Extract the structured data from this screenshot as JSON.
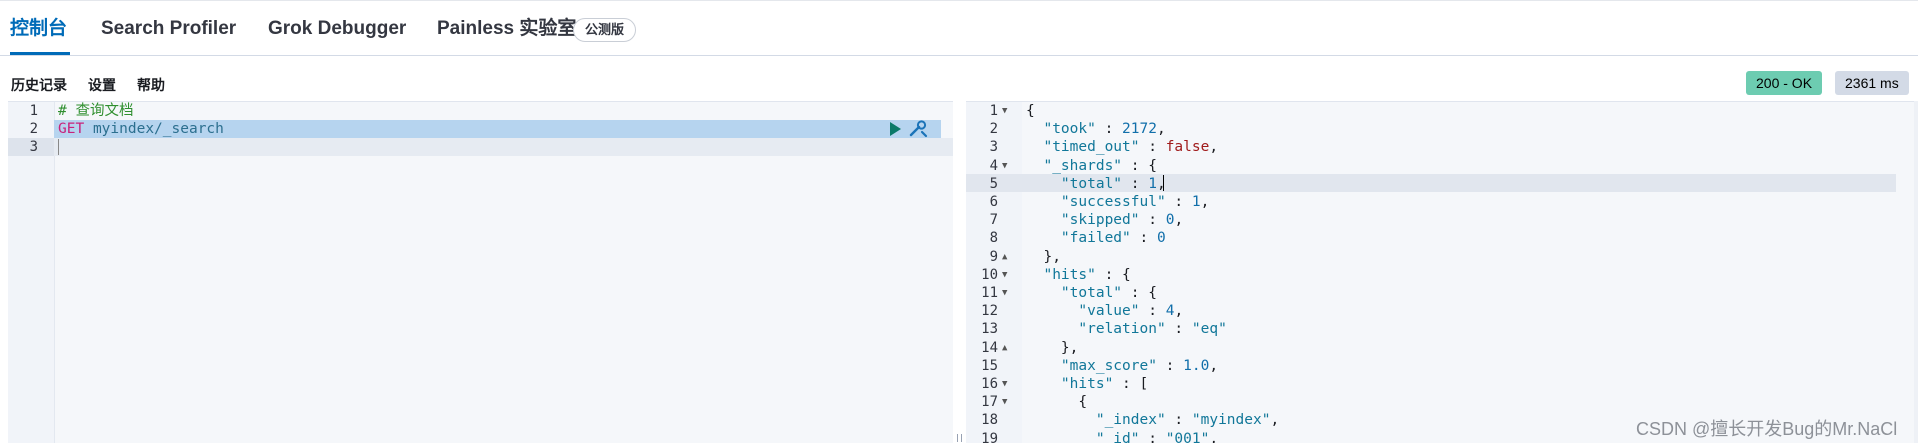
{
  "tabs": [
    {
      "label": "控制台",
      "active": true
    },
    {
      "label": "Search Profiler",
      "active": false
    },
    {
      "label": "Grok Debugger",
      "active": false
    },
    {
      "label": "Painless 实验室",
      "active": false
    }
  ],
  "beta_badge": "公测版",
  "toolbar": {
    "history": "历史记录",
    "settings": "设置",
    "help": "帮助"
  },
  "status": {
    "code": "200 - OK",
    "time": "2361 ms"
  },
  "request": {
    "line_numbers": [
      "1",
      "2",
      "3"
    ],
    "comment": "# 查询文档",
    "method": "GET",
    "path": "myindex/_search"
  },
  "response": {
    "line_numbers": [
      "1",
      "2",
      "3",
      "4",
      "5",
      "6",
      "7",
      "8",
      "9",
      "10",
      "11",
      "12",
      "13",
      "14",
      "15",
      "16",
      "17",
      "18",
      "19"
    ],
    "lines": [
      [
        [
          "p",
          "{"
        ]
      ],
      [
        [
          "k",
          "  \"took\""
        ],
        [
          "p",
          " : "
        ],
        [
          "n",
          "2172"
        ],
        [
          "p",
          ","
        ]
      ],
      [
        [
          "k",
          "  \"timed_out\""
        ],
        [
          "p",
          " : "
        ],
        [
          "b",
          "false"
        ],
        [
          "p",
          ","
        ]
      ],
      [
        [
          "k",
          "  \"_shards\""
        ],
        [
          "p",
          " : {"
        ]
      ],
      [
        [
          "k",
          "    \"total\""
        ],
        [
          "p",
          " : "
        ],
        [
          "n",
          "1"
        ],
        [
          "p",
          ","
        ]
      ],
      [
        [
          "k",
          "    \"successful\""
        ],
        [
          "p",
          " : "
        ],
        [
          "n",
          "1"
        ],
        [
          "p",
          ","
        ]
      ],
      [
        [
          "k",
          "    \"skipped\""
        ],
        [
          "p",
          " : "
        ],
        [
          "n",
          "0"
        ],
        [
          "p",
          ","
        ]
      ],
      [
        [
          "k",
          "    \"failed\""
        ],
        [
          "p",
          " : "
        ],
        [
          "n",
          "0"
        ]
      ],
      [
        [
          "p",
          "  },"
        ]
      ],
      [
        [
          "k",
          "  \"hits\""
        ],
        [
          "p",
          " : {"
        ]
      ],
      [
        [
          "k",
          "    \"total\""
        ],
        [
          "p",
          " : {"
        ]
      ],
      [
        [
          "k",
          "      \"value\""
        ],
        [
          "p",
          " : "
        ],
        [
          "n",
          "4"
        ],
        [
          "p",
          ","
        ]
      ],
      [
        [
          "k",
          "      \"relation\""
        ],
        [
          "p",
          " : "
        ],
        [
          "s",
          "\"eq\""
        ]
      ],
      [
        [
          "p",
          "    },"
        ]
      ],
      [
        [
          "k",
          "    \"max_score\""
        ],
        [
          "p",
          " : "
        ],
        [
          "n",
          "1.0"
        ],
        [
          "p",
          ","
        ]
      ],
      [
        [
          "k",
          "    \"hits\""
        ],
        [
          "p",
          " : ["
        ]
      ],
      [
        [
          "p",
          "      {"
        ]
      ],
      [
        [
          "k",
          "        \"_index\""
        ],
        [
          "p",
          " : "
        ],
        [
          "s",
          "\"myindex\""
        ],
        [
          "p",
          ","
        ]
      ],
      [
        [
          "k",
          "        \"_id\""
        ],
        [
          "p",
          " : "
        ],
        [
          "s",
          "\"001\""
        ],
        [
          "p",
          ","
        ]
      ]
    ]
  },
  "watermark": "CSDN @擅长开发Bug的Mr.NaCl",
  "colors": {
    "accent": "#006bb8",
    "ok": "#6dccb1",
    "time": "#d3dae6"
  }
}
